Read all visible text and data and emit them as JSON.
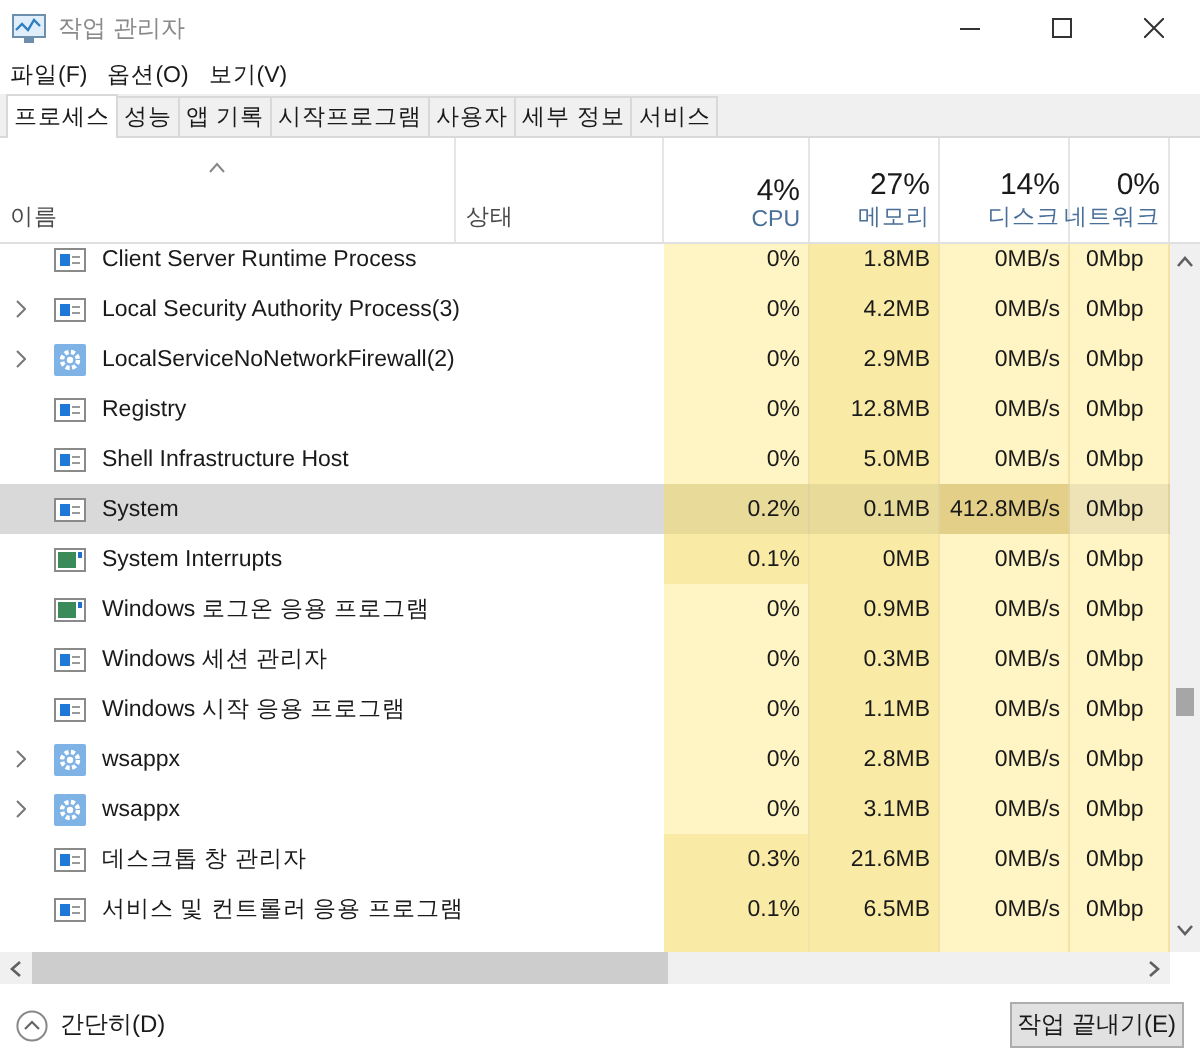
{
  "window": {
    "title": "작업 관리자"
  },
  "menu": [
    "파일(F)",
    "옵션(O)",
    "보기(V)"
  ],
  "tabs": [
    {
      "label": "프로세스",
      "selected": true
    },
    {
      "label": "성능",
      "selected": false
    },
    {
      "label": "앱 기록",
      "selected": false
    },
    {
      "label": "시작프로그램",
      "selected": false
    },
    {
      "label": "사용자",
      "selected": false
    },
    {
      "label": "세부 정보",
      "selected": false
    },
    {
      "label": "서비스",
      "selected": false
    }
  ],
  "columns": [
    {
      "label": "이름"
    },
    {
      "label": "상태"
    },
    {
      "percent": "4%",
      "label": "CPU"
    },
    {
      "percent": "27%",
      "label": "메모리"
    },
    {
      "percent": "14%",
      "label": "디스크"
    },
    {
      "percent": "0%",
      "label": "네트워크"
    }
  ],
  "rows": [
    {
      "kind": "app",
      "expandable": false,
      "selected": false,
      "name": "Client Server Runtime Process",
      "cpu": "0%",
      "cpu_busy": false,
      "memory": "1.8MB",
      "disk": "0MB/s",
      "disk_busy": false,
      "network": "0Mbp"
    },
    {
      "kind": "app",
      "expandable": true,
      "selected": false,
      "name": "Local Security Authority Process(3)",
      "cpu": "0%",
      "cpu_busy": false,
      "memory": "4.2MB",
      "disk": "0MB/s",
      "disk_busy": false,
      "network": "0Mbp"
    },
    {
      "kind": "service",
      "expandable": true,
      "selected": false,
      "name": "LocalServiceNoNetworkFirewall(2)",
      "cpu": "0%",
      "cpu_busy": false,
      "memory": "2.9MB",
      "disk": "0MB/s",
      "disk_busy": false,
      "network": "0Mbp"
    },
    {
      "kind": "app",
      "expandable": false,
      "selected": false,
      "name": "Registry",
      "cpu": "0%",
      "cpu_busy": false,
      "memory": "12.8MB",
      "disk": "0MB/s",
      "disk_busy": false,
      "network": "0Mbp"
    },
    {
      "kind": "app",
      "expandable": false,
      "selected": false,
      "name": "Shell Infrastructure Host",
      "cpu": "0%",
      "cpu_busy": false,
      "memory": "5.0MB",
      "disk": "0MB/s",
      "disk_busy": false,
      "network": "0Mbp"
    },
    {
      "kind": "app",
      "expandable": false,
      "selected": true,
      "name": "System",
      "cpu": "0.2%",
      "cpu_busy": true,
      "memory": "0.1MB",
      "disk": "412.8MB/s",
      "disk_busy": true,
      "network": "0Mbp"
    },
    {
      "kind": "chart",
      "expandable": false,
      "selected": false,
      "name": "System Interrupts",
      "cpu": "0.1%",
      "cpu_busy": true,
      "memory": "0MB",
      "disk": "0MB/s",
      "disk_busy": false,
      "network": "0Mbp"
    },
    {
      "kind": "chart",
      "expandable": false,
      "selected": false,
      "name": "Windows 로그온 응용 프로그램",
      "cpu": "0%",
      "cpu_busy": false,
      "memory": "0.9MB",
      "disk": "0MB/s",
      "disk_busy": false,
      "network": "0Mbp"
    },
    {
      "kind": "app",
      "expandable": false,
      "selected": false,
      "name": "Windows 세션 관리자",
      "cpu": "0%",
      "cpu_busy": false,
      "memory": "0.3MB",
      "disk": "0MB/s",
      "disk_busy": false,
      "network": "0Mbp"
    },
    {
      "kind": "app",
      "expandable": false,
      "selected": false,
      "name": "Windows 시작 응용 프로그램",
      "cpu": "0%",
      "cpu_busy": false,
      "memory": "1.1MB",
      "disk": "0MB/s",
      "disk_busy": false,
      "network": "0Mbp"
    },
    {
      "kind": "service",
      "expandable": true,
      "selected": false,
      "name": "wsappx",
      "cpu": "0%",
      "cpu_busy": false,
      "memory": "2.8MB",
      "disk": "0MB/s",
      "disk_busy": false,
      "network": "0Mbp"
    },
    {
      "kind": "service",
      "expandable": true,
      "selected": false,
      "name": "wsappx",
      "cpu": "0%",
      "cpu_busy": false,
      "memory": "3.1MB",
      "disk": "0MB/s",
      "disk_busy": false,
      "network": "0Mbp"
    },
    {
      "kind": "app",
      "expandable": false,
      "selected": false,
      "name": "데스크톱 창 관리자",
      "cpu": "0.3%",
      "cpu_busy": true,
      "memory": "21.6MB",
      "disk": "0MB/s",
      "disk_busy": false,
      "network": "0Mbp"
    },
    {
      "kind": "app",
      "expandable": false,
      "selected": false,
      "name": "서비스 및 컨트롤러 응용 프로그램",
      "cpu": "0.1%",
      "cpu_busy": true,
      "memory": "6.5MB",
      "disk": "0MB/s",
      "disk_busy": false,
      "network": "0Mbp"
    }
  ],
  "footer": {
    "toggle": "간단히(D)",
    "end_button": "작업 끝내기(E)"
  }
}
